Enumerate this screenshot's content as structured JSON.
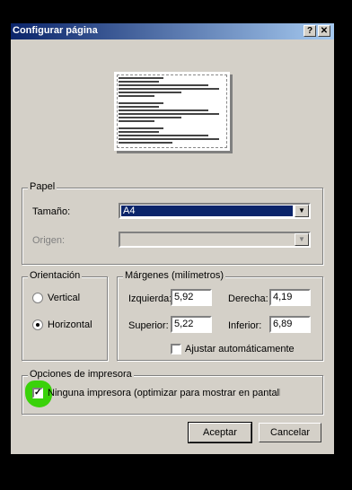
{
  "window": {
    "title": "Configurar página",
    "help_label": "?",
    "close_label": "✕"
  },
  "paper": {
    "legend": "Papel",
    "size_label": "Tamaño:",
    "size_value": "A4",
    "source_label": "Origen:",
    "source_value": ""
  },
  "orientation": {
    "legend": "Orientación",
    "options": [
      "Vertical",
      "Horizontal"
    ],
    "selected": "Horizontal"
  },
  "margins": {
    "legend": "Márgenes (milímetros)",
    "left_label": "Izquierda:",
    "left_value": "5,92",
    "right_label": "Derecha:",
    "right_value": "4,19",
    "top_label": "Superior:",
    "top_value": "5,22",
    "bottom_label": "Inferior:",
    "bottom_value": "6,89",
    "auto_fit_label": "Ajustar automáticamente",
    "auto_fit_checked": false
  },
  "printer": {
    "legend": "Opciones de impresora",
    "no_printer_label": "Ninguna impresora (optimizar para mostrar en pantalla",
    "no_printer_checked": true
  },
  "buttons": {
    "ok": "Aceptar",
    "cancel": "Cancelar"
  },
  "colors": {
    "title_bar": "#0a246a",
    "dialog_bg": "#d4d0c8",
    "highlight_mark": "#32d200"
  }
}
